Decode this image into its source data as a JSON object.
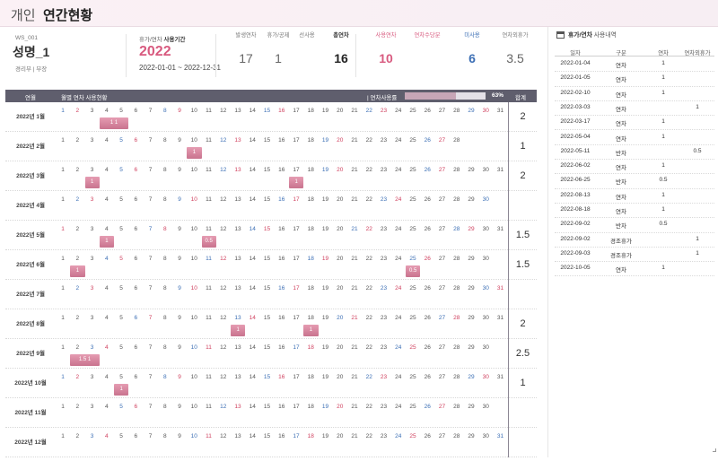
{
  "page": {
    "title_prefix": "개인",
    "title_main": "연간현황"
  },
  "employee": {
    "code": "WS_001",
    "name": "성명_1",
    "dept": "경리부 | 부장"
  },
  "period": {
    "label_prefix": "휴가/연차",
    "label_bold": "사용기간",
    "year": "2022",
    "dates": "2022-01-01 ~ 2022-12-31"
  },
  "stats": [
    {
      "label": "발생연차",
      "value": "17",
      "style": "plain"
    },
    {
      "label": "휴가/공제",
      "value": "1",
      "style": "plain"
    },
    {
      "label": "선사용",
      "value": "",
      "style": "plain"
    },
    {
      "label": "총연차",
      "value": "16",
      "style": "bold"
    },
    {
      "label": "사용연차",
      "value": "10",
      "style": "red"
    },
    {
      "label": "연차수당분",
      "value": "",
      "style": "red"
    },
    {
      "label": "미사용",
      "value": "6",
      "style": "blue"
    },
    {
      "label": "연차외휴가",
      "value": "3.5",
      "style": "plain"
    }
  ],
  "grid": {
    "col_month": "연월",
    "col_usage": "월별 연차 사용현황",
    "rate_label": "| 연차사용률",
    "rate_value": 0.63,
    "rate_text": "63%",
    "col_total": "합계",
    "months": [
      {
        "label": "2022년 1월",
        "days": 31,
        "first_dow": 6,
        "total": "2",
        "marks": [
          {
            "from": 4,
            "to": 5,
            "text": "1    1"
          }
        ]
      },
      {
        "label": "2022년 2월",
        "days": 28,
        "first_dow": 2,
        "total": "1",
        "marks": [
          {
            "from": 10,
            "to": 10,
            "text": "1"
          }
        ]
      },
      {
        "label": "2022년 3월",
        "days": 31,
        "first_dow": 2,
        "total": "2",
        "marks": [
          {
            "from": 3,
            "to": 3,
            "text": "1"
          },
          {
            "from": 17,
            "to": 17,
            "text": "1"
          }
        ]
      },
      {
        "label": "2022년 4월",
        "days": 30,
        "first_dow": 5,
        "total": "",
        "marks": []
      },
      {
        "label": "2022년 5월",
        "days": 31,
        "first_dow": 0,
        "total": "1.5",
        "marks": [
          {
            "from": 4,
            "to": 4,
            "text": "1"
          },
          {
            "from": 11,
            "to": 11,
            "text": "0.5"
          }
        ]
      },
      {
        "label": "2022년 6월",
        "days": 30,
        "first_dow": 3,
        "total": "1.5",
        "marks": [
          {
            "from": 2,
            "to": 2,
            "text": "1"
          },
          {
            "from": 25,
            "to": 25,
            "text": "0.5"
          }
        ]
      },
      {
        "label": "2022년 7월",
        "days": 31,
        "first_dow": 5,
        "total": "",
        "marks": []
      },
      {
        "label": "2022년 8월",
        "days": 31,
        "first_dow": 1,
        "total": "2",
        "marks": [
          {
            "from": 13,
            "to": 13,
            "text": "1"
          },
          {
            "from": 18,
            "to": 18,
            "text": "1"
          }
        ]
      },
      {
        "label": "2022년 9월",
        "days": 30,
        "first_dow": 4,
        "total": "2.5",
        "marks": [
          {
            "from": 2,
            "to": 3,
            "text": "1.5    1"
          }
        ]
      },
      {
        "label": "2022년 10월",
        "days": 31,
        "first_dow": 6,
        "total": "1",
        "marks": [
          {
            "from": 5,
            "to": 5,
            "text": "1"
          }
        ]
      },
      {
        "label": "2022년 11월",
        "days": 30,
        "first_dow": 2,
        "total": "",
        "marks": []
      },
      {
        "label": "2022년 12월",
        "days": 31,
        "first_dow": 4,
        "total": "",
        "marks": []
      }
    ]
  },
  "side": {
    "title": "휴가/연차",
    "title_light": "사용내역",
    "headers": [
      "일자",
      "구분",
      "연차",
      "연차외휴가"
    ],
    "rows": [
      [
        "2022-01-04",
        "연차",
        "1",
        ""
      ],
      [
        "2022-01-05",
        "연차",
        "1",
        ""
      ],
      [
        "2022-02-10",
        "연차",
        "1",
        ""
      ],
      [
        "2022-03-03",
        "연차",
        "",
        "1"
      ],
      [
        "2022-03-17",
        "연차",
        "1",
        ""
      ],
      [
        "2022-05-04",
        "연차",
        "1",
        ""
      ],
      [
        "2022-05-11",
        "반차",
        "",
        "0.5"
      ],
      [
        "2022-06-02",
        "연차",
        "1",
        ""
      ],
      [
        "2022-06-25",
        "반차",
        "0.5",
        ""
      ],
      [
        "2022-08-13",
        "연차",
        "1",
        ""
      ],
      [
        "2022-08-18",
        "연차",
        "1",
        ""
      ],
      [
        "2022-09-02",
        "반차",
        "0.5",
        ""
      ],
      [
        "2022-09-02",
        "경조휴가",
        "",
        "1"
      ],
      [
        "2022-09-03",
        "경조휴가",
        "",
        "1"
      ],
      [
        "2022-10-05",
        "연차",
        "1",
        ""
      ]
    ]
  }
}
